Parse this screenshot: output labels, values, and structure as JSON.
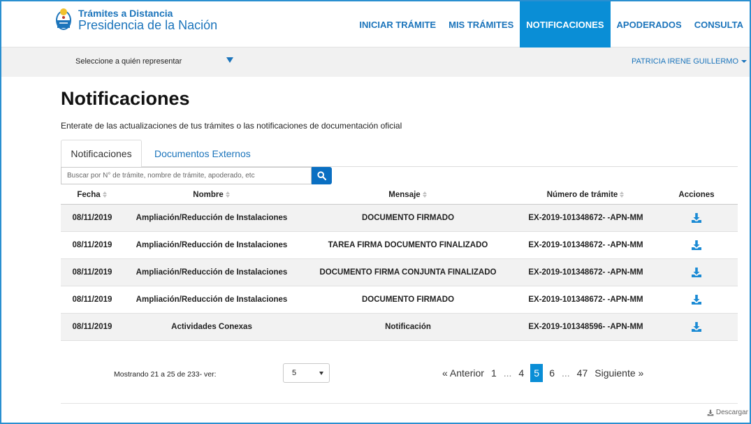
{
  "brand": {
    "line1": "Trámites a Distancia",
    "line2": "Presidencia de la Nación"
  },
  "nav": [
    {
      "label": "INICIAR TRÁMITE",
      "active": false
    },
    {
      "label": "MIS TRÁMITES",
      "active": false
    },
    {
      "label": "NOTIFICACIONES",
      "active": true
    },
    {
      "label": "APODERADOS",
      "active": false
    },
    {
      "label": "CONSULTA",
      "active": false
    }
  ],
  "subbar": {
    "represent_label": "Seleccione a quién representar",
    "user_name": "PATRICIA IRENE GUILLERMO"
  },
  "page": {
    "title": "Notificaciones",
    "subtitle": "Enterate de las actualizaciones de tus trámites o las notificaciones de documentación oficial"
  },
  "tabs": [
    {
      "label": "Notificaciones",
      "active": true
    },
    {
      "label": "Documentos Externos",
      "active": false
    }
  ],
  "search": {
    "placeholder": "Buscar por N° de trámite, nombre de trámite, apoderado, etc",
    "button_icon": "search-icon"
  },
  "table": {
    "headers": [
      "Fecha",
      "Nombre",
      "Mensaje",
      "Número de trámite",
      "Acciones"
    ],
    "rows": [
      {
        "fecha": "08/11/2019",
        "nombre": "Ampliación/Reducción de Instalaciones",
        "mensaje": "DOCUMENTO FIRMADO",
        "numero": "EX-2019-101348672- -APN-MM"
      },
      {
        "fecha": "08/11/2019",
        "nombre": "Ampliación/Reducción de Instalaciones",
        "mensaje": "TAREA FIRMA DOCUMENTO FINALIZADO",
        "numero": "EX-2019-101348672- -APN-MM"
      },
      {
        "fecha": "08/11/2019",
        "nombre": "Ampliación/Reducción de Instalaciones",
        "mensaje": "DOCUMENTO FIRMA CONJUNTA FINALIZADO",
        "numero": "EX-2019-101348672- -APN-MM"
      },
      {
        "fecha": "08/11/2019",
        "nombre": "Ampliación/Reducción de Instalaciones",
        "mensaje": "DOCUMENTO FIRMADO",
        "numero": "EX-2019-101348672- -APN-MM"
      },
      {
        "fecha": "08/11/2019",
        "nombre": "Actividades Conexas",
        "mensaje": "Notificación",
        "numero": "EX-2019-101348596- -APN-MM"
      }
    ],
    "action_icon": "download-icon"
  },
  "pagination": {
    "showing_text": "Mostrando 21 a 25 de 233- ver:",
    "page_size": "5",
    "prev_label": "« Anterior",
    "next_label": "Siguiente »",
    "pages": [
      "1",
      "...",
      "4",
      "5",
      "6",
      "...",
      "47"
    ],
    "current_page": "5"
  },
  "footer": {
    "download_label": "Descargar"
  },
  "colors": {
    "accent": "#0a8ed6",
    "link": "#1b74bb",
    "button": "#0a6fc2"
  }
}
